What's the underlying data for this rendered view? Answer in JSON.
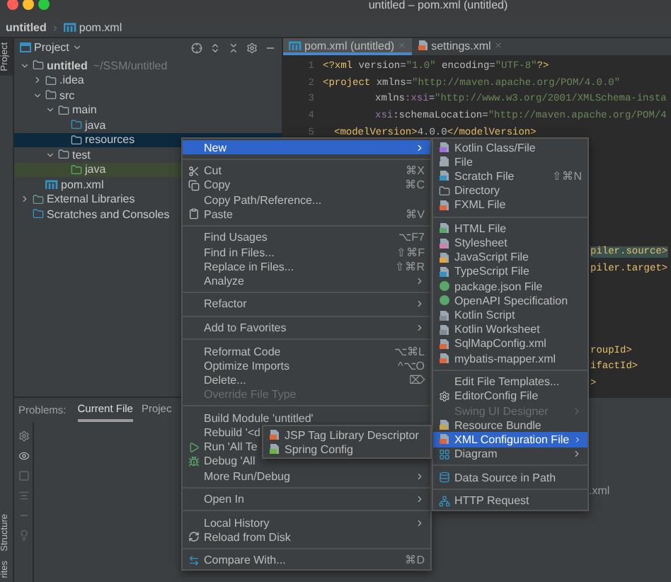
{
  "window": {
    "title": "untitled – pom.xml (untitled)"
  },
  "breadcrumb": [
    {
      "label": "untitled",
      "kind": "project"
    },
    {
      "label": "pom.xml",
      "kind": "maven"
    }
  ],
  "left_strip": [
    {
      "label": "Project",
      "kind": "top",
      "selected": true
    },
    {
      "label": "Structure",
      "kind": "bottom",
      "selected": false
    },
    {
      "label": "rites",
      "kind": "bottom",
      "selected": false
    }
  ],
  "project_panel": {
    "title": "Project",
    "tree": [
      {
        "label": "untitled",
        "hint": "~/SSM/untitled",
        "kind": "module",
        "expanded": true,
        "selected": false,
        "hovered": false,
        "children": [
          {
            "label": ".idea",
            "kind": "folder",
            "expanded": false,
            "selected": false,
            "hovered": false
          },
          {
            "label": "src",
            "kind": "folder",
            "expanded": true,
            "selected": false,
            "hovered": false,
            "children": [
              {
                "label": "main",
                "kind": "folder",
                "expanded": true,
                "selected": false,
                "hovered": false,
                "children": [
                  {
                    "label": "java",
                    "kind": "source",
                    "selected": false,
                    "hovered": false
                  },
                  {
                    "label": "resources",
                    "kind": "resources",
                    "selected": true,
                    "hovered": false
                  }
                ]
              },
              {
                "label": "test",
                "kind": "folder",
                "expanded": true,
                "selected": false,
                "hovered": false,
                "children": [
                  {
                    "label": "java",
                    "kind": "test",
                    "selected": false,
                    "hovered": true
                  }
                ]
              }
            ]
          },
          {
            "label": "pom.xml",
            "kind": "maven",
            "selected": false,
            "hovered": false
          }
        ]
      },
      {
        "label": "External Libraries",
        "kind": "library",
        "expanded": false,
        "selected": false,
        "hovered": false
      },
      {
        "label": "Scratches and Consoles",
        "kind": "scratches",
        "selected": false,
        "hovered": false
      }
    ]
  },
  "editor": {
    "tabs": [
      {
        "label": "pom.xml (untitled)",
        "kind": "maven",
        "selected": true
      },
      {
        "label": "settings.xml",
        "kind": "xml",
        "selected": false
      }
    ],
    "lines": [
      {
        "number": "1",
        "kind": "top",
        "tokens": [
          {
            "text": "<?xml ",
            "kind": "tag"
          },
          {
            "text": "version",
            "kind": "attr"
          },
          {
            "text": "=",
            "kind": "plain"
          },
          {
            "text": "\"1.0\"",
            "kind": "str"
          },
          {
            "text": " encoding",
            "kind": "attr"
          },
          {
            "text": "=",
            "kind": "plain"
          },
          {
            "text": "\"UTF-8\"",
            "kind": "str"
          },
          {
            "text": "?>",
            "kind": "tag"
          }
        ]
      },
      {
        "number": "2",
        "kind": "top",
        "tokens": [
          {
            "text": "<project ",
            "kind": "tag"
          },
          {
            "text": "xmlns",
            "kind": "attr"
          },
          {
            "text": "=",
            "kind": "plain"
          },
          {
            "text": "\"http://maven.apache.org/POM/4.0.0\"",
            "kind": "str"
          }
        ]
      },
      {
        "number": "3",
        "kind": "attr",
        "tokens": [
          {
            "text": "xmlns",
            "kind": "attr"
          },
          {
            "text": ":xsi",
            "kind": "ns"
          },
          {
            "text": "=",
            "kind": "plain"
          },
          {
            "text": "\"http://www.w3.org/2001/XMLSchema-insta",
            "kind": "str"
          }
        ]
      },
      {
        "number": "4",
        "kind": "attr",
        "tokens": [
          {
            "text": "xsi",
            "kind": "ns"
          },
          {
            "text": ":schemaLocation",
            "kind": "attr"
          },
          {
            "text": "=",
            "kind": "plain"
          },
          {
            "text": "\"http://maven.apache.org/POM/4",
            "kind": "str"
          }
        ]
      },
      {
        "number": "5",
        "kind": "child",
        "tokens": [
          {
            "text": "<modelVersion>",
            "kind": "tag"
          },
          {
            "text": "4.0.0",
            "kind": "plain"
          },
          {
            "text": "</modelVersion>",
            "kind": "tag"
          }
        ]
      }
    ],
    "tail_groups": [
      [
        {
          "text": "piler.source>",
          "highlighted": true
        },
        {
          "text": "piler.target>",
          "highlighted": false
        }
      ],
      [
        {
          "text": "roupId>",
          "highlighted": false
        },
        {
          "text": "ifactId>",
          "highlighted": false
        },
        {
          "text": ">",
          "highlighted": false
        }
      ]
    ]
  },
  "bottom_panel": {
    "tabs": [
      {
        "label": "Problems:",
        "kind": "title"
      },
      {
        "label": "Current File",
        "kind": "tab",
        "selected": true
      },
      {
        "label": "Projec",
        "kind": "tab",
        "selected": false
      }
    ],
    "content": ".xml"
  },
  "context_menu": [
    [
      {
        "label": "New",
        "kind": "plain",
        "submenu": true,
        "selected": true,
        "disabled": false
      }
    ],
    [
      {
        "label": "Cut",
        "kind": "cut",
        "shortcut": "⌘X",
        "submenu": false,
        "selected": false,
        "disabled": false
      },
      {
        "label": "Copy",
        "kind": "copy",
        "shortcut": "⌘C",
        "submenu": false,
        "selected": false,
        "disabled": false
      },
      {
        "label": "Copy Path/Reference...",
        "kind": "plain",
        "submenu": false,
        "selected": false,
        "disabled": false
      },
      {
        "label": "Paste",
        "kind": "paste",
        "shortcut": "⌘V",
        "submenu": false,
        "selected": false,
        "disabled": false
      }
    ],
    [
      {
        "label": "Find Usages",
        "kind": "plain",
        "shortcut": "⌥F7",
        "submenu": false,
        "selected": false,
        "disabled": false
      },
      {
        "label": "Find in Files...",
        "kind": "plain",
        "shortcut": "⇧⌘F",
        "submenu": false,
        "selected": false,
        "disabled": false
      },
      {
        "label": "Replace in Files...",
        "kind": "plain",
        "shortcut": "⇧⌘R",
        "submenu": false,
        "selected": false,
        "disabled": false
      },
      {
        "label": "Analyze",
        "kind": "plain",
        "submenu": true,
        "selected": false,
        "disabled": false
      }
    ],
    [
      {
        "label": "Refactor",
        "kind": "plain",
        "submenu": true,
        "selected": false,
        "disabled": false
      }
    ],
    [
      {
        "label": "Add to Favorites",
        "kind": "plain",
        "submenu": true,
        "selected": false,
        "disabled": false
      }
    ],
    [
      {
        "label": "Reformat Code",
        "kind": "plain",
        "shortcut": "⌥⌘L",
        "submenu": false,
        "selected": false,
        "disabled": false
      },
      {
        "label": "Optimize Imports",
        "kind": "plain",
        "shortcut": "^⌥O",
        "submenu": false,
        "selected": false,
        "disabled": false
      },
      {
        "label": "Delete...",
        "kind": "plain",
        "shortcut": "⌦",
        "submenu": false,
        "selected": false,
        "disabled": false
      },
      {
        "label": "Override File Type",
        "kind": "plain",
        "submenu": false,
        "selected": false,
        "disabled": true
      }
    ],
    [
      {
        "label": "Build Module 'untitled'",
        "kind": "plain",
        "submenu": false,
        "selected": false,
        "disabled": false
      },
      {
        "label": "Rebuild '<d",
        "kind": "plain",
        "selected": false,
        "disabled": false
      },
      {
        "label": "Run 'All Te",
        "kind": "run",
        "selected": false,
        "disabled": false
      },
      {
        "label": "Debug 'All",
        "kind": "debug",
        "selected": false,
        "disabled": false
      },
      {
        "label": "More Run/Debug",
        "kind": "plain",
        "submenu": true,
        "selected": false,
        "disabled": false
      }
    ],
    [
      {
        "label": "Open In",
        "kind": "plain",
        "submenu": true,
        "selected": false,
        "disabled": false
      }
    ],
    [
      {
        "label": "Local History",
        "kind": "plain",
        "submenu": true,
        "selected": false,
        "disabled": false
      },
      {
        "label": "Reload from Disk",
        "kind": "reload",
        "submenu": false,
        "selected": false,
        "disabled": false
      }
    ],
    [
      {
        "label": "Compare With...",
        "kind": "compare",
        "shortcut": "⌘D",
        "submenu": false,
        "selected": false,
        "disabled": false
      }
    ]
  ],
  "new_submenu": [
    [
      {
        "label": "Kotlin Class/File",
        "kind": "kotlin",
        "submenu": false,
        "selected": false,
        "disabled": false
      },
      {
        "label": "File",
        "kind": "file",
        "submenu": false,
        "selected": false,
        "disabled": false
      },
      {
        "label": "Scratch File",
        "kind": "scratch",
        "shortcut": "⇧⌘N",
        "submenu": false,
        "selected": false,
        "disabled": false
      },
      {
        "label": "Directory",
        "kind": "folder",
        "submenu": false,
        "selected": false,
        "disabled": false
      },
      {
        "label": "FXML File",
        "kind": "fxml",
        "submenu": false,
        "selected": false,
        "disabled": false
      }
    ],
    [
      {
        "label": "HTML File",
        "kind": "html",
        "submenu": false,
        "selected": false,
        "disabled": false
      },
      {
        "label": "Stylesheet",
        "kind": "css",
        "submenu": false,
        "selected": false,
        "disabled": false
      },
      {
        "label": "JavaScript File",
        "kind": "js",
        "submenu": false,
        "selected": false,
        "disabled": false
      },
      {
        "label": "TypeScript File",
        "kind": "ts",
        "submenu": false,
        "selected": false,
        "disabled": false
      },
      {
        "label": "package.json File",
        "kind": "json",
        "submenu": false,
        "selected": false,
        "disabled": false
      },
      {
        "label": "OpenAPI Specification",
        "kind": "openapi",
        "submenu": false,
        "selected": false,
        "disabled": false
      },
      {
        "label": "Kotlin Script",
        "kind": "kscript",
        "submenu": false,
        "selected": false,
        "disabled": false
      },
      {
        "label": "Kotlin Worksheet",
        "kind": "kscript",
        "submenu": false,
        "selected": false,
        "disabled": false
      },
      {
        "label": "SqlMapConfig.xml",
        "kind": "xml",
        "submenu": false,
        "selected": false,
        "disabled": false
      },
      {
        "label": "mybatis-mapper.xml",
        "kind": "xml",
        "submenu": false,
        "selected": false,
        "disabled": false
      }
    ],
    [
      {
        "label": "Edit File Templates...",
        "kind": "plain",
        "submenu": false,
        "selected": false,
        "disabled": false
      },
      {
        "label": "EditorConfig File",
        "kind": "gear",
        "submenu": false,
        "selected": false,
        "disabled": false
      },
      {
        "label": "Swing UI Designer",
        "kind": "plain",
        "submenu": true,
        "selected": false,
        "disabled": true
      },
      {
        "label": "Resource Bundle",
        "kind": "bundle",
        "submenu": false,
        "selected": false,
        "disabled": false
      },
      {
        "label": "XML Configuration File",
        "kind": "xml",
        "submenu": true,
        "selected": true,
        "disabled": false
      },
      {
        "label": "Diagram",
        "kind": "diagram",
        "submenu": true,
        "selected": false,
        "disabled": false
      }
    ],
    [
      {
        "label": "Data Source in Path",
        "kind": "db",
        "submenu": false,
        "selected": false,
        "disabled": false
      }
    ],
    [
      {
        "label": "HTTP Request",
        "kind": "http",
        "submenu": false,
        "selected": false,
        "disabled": false
      }
    ]
  ],
  "xml_submenu": [
    [
      {
        "label": "JSP Tag Library Descriptor",
        "kind": "xml",
        "selected": false,
        "disabled": false
      },
      {
        "label": "Spring Config",
        "kind": "spring",
        "selected": false,
        "disabled": false
      }
    ]
  ]
}
